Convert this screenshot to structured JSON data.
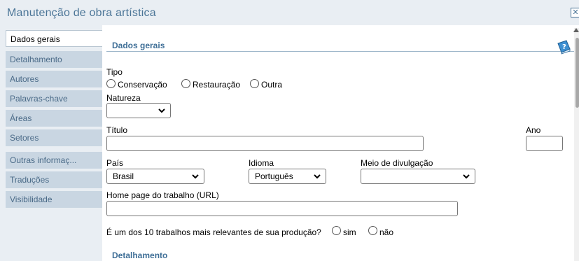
{
  "window": {
    "title": "Manutenção de obra artística",
    "close_glyph": "✕"
  },
  "sidebar": {
    "items": [
      {
        "label": "Dados gerais",
        "active": true
      },
      {
        "label": "Detalhamento"
      },
      {
        "label": "Autores"
      },
      {
        "label": "Palavras-chave"
      },
      {
        "label": "Áreas"
      },
      {
        "label": "Setores"
      },
      {
        "label": "Outras informaç..."
      },
      {
        "label": "Traduções"
      },
      {
        "label": "Visibilidade"
      }
    ]
  },
  "main": {
    "section_title": "Dados gerais",
    "help_icon": "help-book-icon",
    "tipo": {
      "label": "Tipo",
      "options": [
        "Conservação",
        "Restauração",
        "Outra"
      ]
    },
    "natureza": {
      "label": "Natureza",
      "value": ""
    },
    "titulo": {
      "label": "Título",
      "value": ""
    },
    "ano": {
      "label": "Ano",
      "value": ""
    },
    "pais": {
      "label": "País",
      "value": "Brasil"
    },
    "idioma": {
      "label": "Idioma",
      "value": "Português"
    },
    "meio": {
      "label": "Meio de divulgação",
      "value": ""
    },
    "homepage": {
      "label": "Home page do trabalho (URL)",
      "value": ""
    },
    "relevante": {
      "question": "É um dos 10 trabalhos mais relevantes de sua produção?",
      "options": [
        "sim",
        "não"
      ]
    },
    "next_section_title": "Detalhamento"
  }
}
